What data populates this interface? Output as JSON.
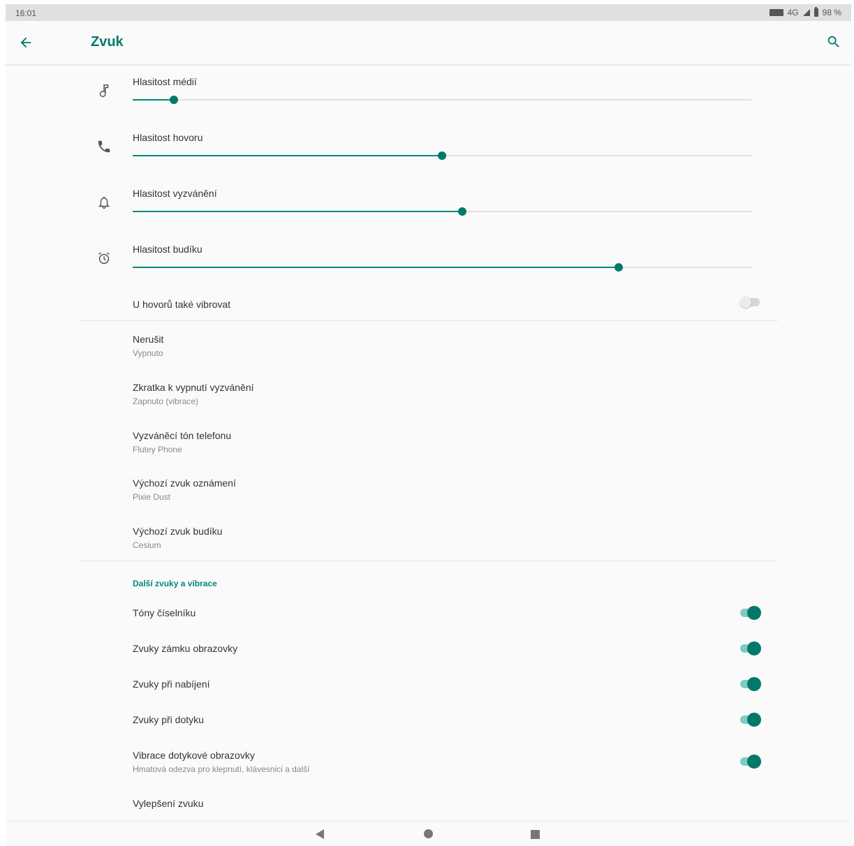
{
  "status_bar": {
    "time": "16:01",
    "network": "4G",
    "battery": "98 %"
  },
  "toolbar": {
    "title": "Zvuk"
  },
  "volumes": [
    {
      "label": "Hlasitost médií",
      "icon": "music-note-icon",
      "level": 0.067
    },
    {
      "label": "Hlasitost hovoru",
      "icon": "phone-icon",
      "level": 0.5
    },
    {
      "label": "Hlasitost vyzvánění",
      "icon": "bell-icon",
      "level": 0.533
    },
    {
      "label": "Hlasitost budíku",
      "icon": "alarm-icon",
      "level": 0.786
    }
  ],
  "vibrate": {
    "label": "U hovorů také vibrovat",
    "on": false
  },
  "settings": [
    {
      "primary": "Nerušit",
      "secondary": "Vypnuto"
    },
    {
      "primary": "Zkratka k vypnutí vyzvánění",
      "secondary": "Zapnuto (vibrace)"
    },
    {
      "primary": "Vyzváněcí tón telefonu",
      "secondary": "Flutey Phone"
    },
    {
      "primary": "Výchozí zvuk oznámení",
      "secondary": "Pixie Dust"
    },
    {
      "primary": "Výchozí zvuk budíku",
      "secondary": "Cesium"
    }
  ],
  "section": {
    "header": "Další zvuky a vibrace"
  },
  "toggles": [
    {
      "primary": "Tóny číselníku",
      "secondary": "",
      "on": true
    },
    {
      "primary": "Zvuky zámku obrazovky",
      "secondary": "",
      "on": true
    },
    {
      "primary": "Zvuky při nabíjení",
      "secondary": "",
      "on": true
    },
    {
      "primary": "Zvuky při dotyku",
      "secondary": "",
      "on": true
    },
    {
      "primary": "Vibrace dotykové obrazovky",
      "secondary": "Hmatová odezva pro klepnutí, klávesnici a další",
      "on": true
    }
  ],
  "last_item": {
    "primary": "Vylepšení zvuku"
  },
  "colors": {
    "accent": "#00796b",
    "accent_light": "#80cbc4",
    "track": "#e0e0e0"
  }
}
